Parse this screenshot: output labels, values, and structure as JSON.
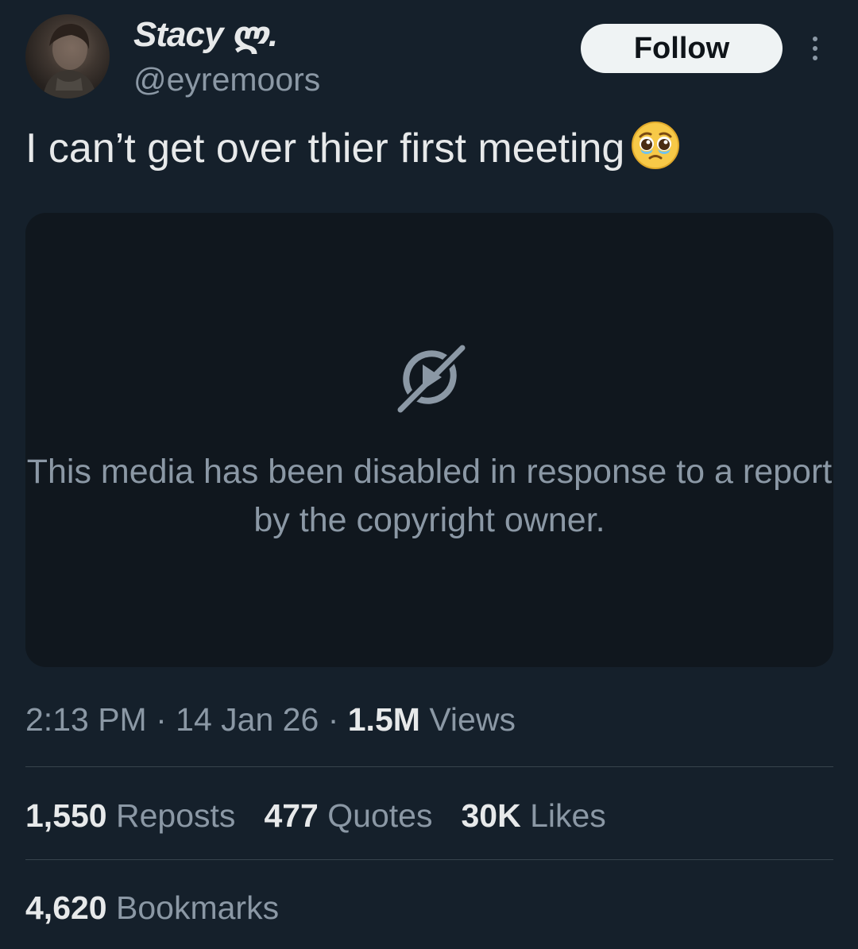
{
  "author": {
    "display_name": "Stacy ლ.",
    "handle": "@eyremoors",
    "avatar": "profile-photo"
  },
  "header": {
    "follow_label": "Follow",
    "more_icon": "more-vertical-icon"
  },
  "tweet": {
    "text": "I can’t get over thier first meeting",
    "emoji": "pleading-face-emoji"
  },
  "media": {
    "icon": "media-disabled-icon",
    "message": "This media has been disabled in response to a report by the copyright owner."
  },
  "meta": {
    "time": "2:13 PM",
    "separator": "·",
    "date": "14 Jan 26",
    "views_count": "1.5M",
    "views_label": "Views"
  },
  "stats": {
    "reposts_count": "1,550",
    "reposts_label": "Reposts",
    "quotes_count": "477",
    "quotes_label": "Quotes",
    "likes_count": "30K",
    "likes_label": "Likes",
    "bookmarks_count": "4,620",
    "bookmarks_label": "Bookmarks"
  },
  "colors": {
    "background": "#15202b",
    "media_background": "#10171e",
    "primary_text": "#e7e9ea",
    "secondary_text": "#8b98a5",
    "divider": "#38444d",
    "follow_button_bg": "#eff3f4"
  }
}
